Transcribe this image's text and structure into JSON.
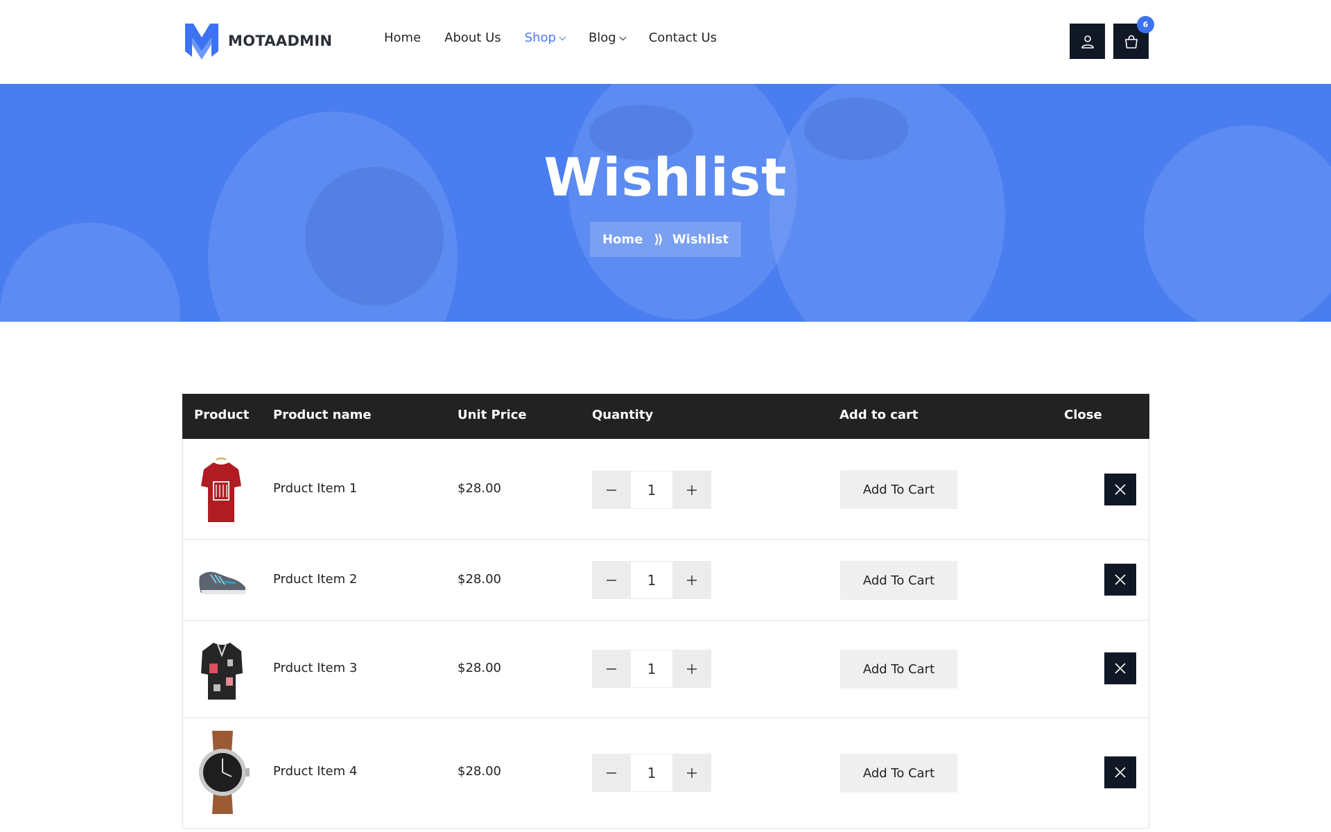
{
  "brand": {
    "name": "MOTAADMIN",
    "logo_color": "#3d73f2"
  },
  "nav": {
    "items": [
      {
        "label": "Home",
        "active": false,
        "dropdown": false
      },
      {
        "label": "About Us",
        "active": false,
        "dropdown": false
      },
      {
        "label": "Shop",
        "active": true,
        "dropdown": true
      },
      {
        "label": "Blog",
        "active": false,
        "dropdown": true
      },
      {
        "label": "Contact Us",
        "active": false,
        "dropdown": false
      }
    ]
  },
  "header_actions": {
    "user_icon": "user-icon",
    "cart_icon": "shopping-bag-icon",
    "cart_count": "6"
  },
  "hero": {
    "title": "Wishlist",
    "breadcrumb": {
      "home": "Home",
      "current": "Wishlist"
    },
    "bg_color": "#4a7ef0"
  },
  "table": {
    "headers": {
      "product": "Product",
      "name": "Product name",
      "price": "Unit Price",
      "quantity": "Quantity",
      "add": "Add to cart",
      "close": "Close"
    },
    "rows": [
      {
        "image": "red-tshirt",
        "name": "Prduct Item 1",
        "price": "$28.00",
        "qty": "1",
        "add_label": "Add To Cart"
      },
      {
        "image": "sneaker",
        "name": "Prduct Item 2",
        "price": "$28.00",
        "qty": "1",
        "add_label": "Add To Cart"
      },
      {
        "image": "printed-shirt",
        "name": "Prduct Item 3",
        "price": "$28.00",
        "qty": "1",
        "add_label": "Add To Cart"
      },
      {
        "image": "wrist-watch",
        "name": "Prduct Item 4",
        "price": "$28.00",
        "qty": "1",
        "add_label": "Add To Cart"
      }
    ]
  }
}
